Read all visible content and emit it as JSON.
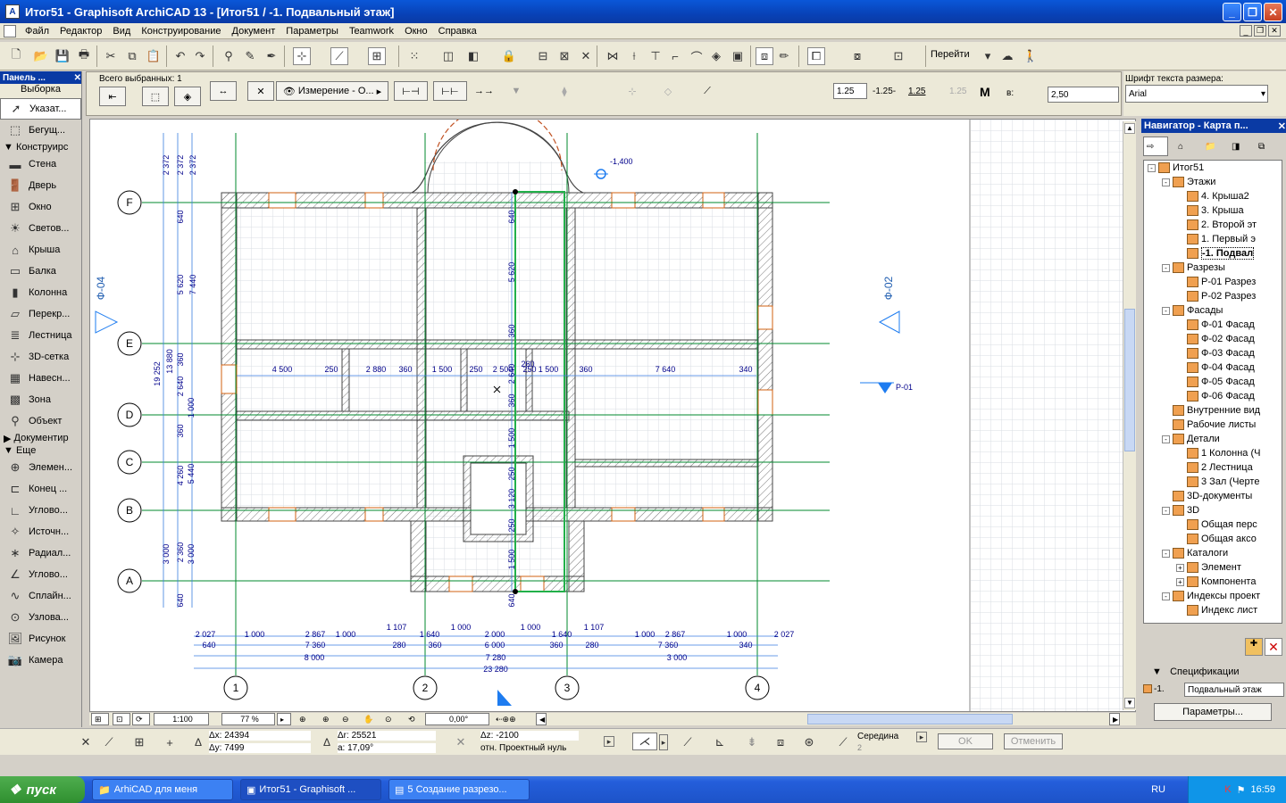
{
  "window": {
    "title": "Итог51 - Graphisoft ArchiCAD 13 - [Итог51 / -1. Подвальный этаж]"
  },
  "menu": [
    "Файл",
    "Редактор",
    "Вид",
    "Конструирование",
    "Документ",
    "Параметры",
    "Teamwork",
    "Окно",
    "Справка"
  ],
  "toolbar": {
    "goto": "Перейти"
  },
  "palette": {
    "title": "Панель ...",
    "selection": "Выборка",
    "pointer": "Указат...",
    "marquee": "Бегущ...",
    "section_design": "Конструирс",
    "design_tools": [
      "Стена",
      "Дверь",
      "Окно",
      "Светов...",
      "Крыша",
      "Балка",
      "Колонна",
      "Перекр...",
      "Лестница",
      "3D-сетка",
      "Навесн...",
      "Зона",
      "Объект"
    ],
    "section_doc": "Документир",
    "section_more": "Еще",
    "more_tools": [
      "Элемен...",
      "Конец ...",
      "Углово...",
      "Источн...",
      "Радиал...",
      "Углово...",
      "Сплайн...",
      "Узлова...",
      "Рисунок",
      "Камера"
    ]
  },
  "infobox": {
    "selected": "Всего выбранных: 1",
    "dim_type": "Измерение - О...",
    "val1": "1.25",
    "val2": "-1.25-",
    "val3": "1.25",
    "val4": "1.25",
    "scale_label": "в:",
    "scale_value": "2,50",
    "font_label": "Шрифт текста размера:",
    "font_value": "Arial"
  },
  "navigator": {
    "title": "Навигатор - Карта п...",
    "tree": [
      {
        "label": "Итог51",
        "level": 0,
        "exp": "-"
      },
      {
        "label": "Этажи",
        "level": 1,
        "exp": "-"
      },
      {
        "label": "4. Крыша2",
        "level": 2
      },
      {
        "label": "3. Крыша",
        "level": 2
      },
      {
        "label": "2. Второй эт",
        "level": 2
      },
      {
        "label": "1. Первый э",
        "level": 2
      },
      {
        "label": "-1. Подвал",
        "level": 2,
        "bold": true
      },
      {
        "label": "Разрезы",
        "level": 1,
        "exp": "-"
      },
      {
        "label": "Р-01 Разрез",
        "level": 2
      },
      {
        "label": "Р-02 Разрез",
        "level": 2
      },
      {
        "label": "Фасады",
        "level": 1,
        "exp": "-"
      },
      {
        "label": "Ф-01 Фасад",
        "level": 2
      },
      {
        "label": "Ф-02 Фасад",
        "level": 2
      },
      {
        "label": "Ф-03 Фасад",
        "level": 2
      },
      {
        "label": "Ф-04 Фасад",
        "level": 2
      },
      {
        "label": "Ф-05 Фасад",
        "level": 2
      },
      {
        "label": "Ф-06 Фасад",
        "level": 2
      },
      {
        "label": "Внутренние вид",
        "level": 1
      },
      {
        "label": "Рабочие листы",
        "level": 1
      },
      {
        "label": "Детали",
        "level": 1,
        "exp": "-"
      },
      {
        "label": "1 Колонна (Ч",
        "level": 2
      },
      {
        "label": "2 Лестница",
        "level": 2
      },
      {
        "label": "3 Зал (Черте",
        "level": 2
      },
      {
        "label": "3D-документы",
        "level": 1
      },
      {
        "label": "3D",
        "level": 1,
        "exp": "-"
      },
      {
        "label": "Общая перс",
        "level": 2
      },
      {
        "label": "Общая аксо",
        "level": 2
      },
      {
        "label": "Каталоги",
        "level": 1,
        "exp": "-"
      },
      {
        "label": "Элемент",
        "level": 2,
        "exp": "+"
      },
      {
        "label": "Компонента",
        "level": 2,
        "exp": "+"
      },
      {
        "label": "Индексы проект",
        "level": 1,
        "exp": "-"
      },
      {
        "label": "Индекс лист",
        "level": 2
      }
    ],
    "spec_title": "Спецификации",
    "story_num": "-1.",
    "story_name": "Подвальный этаж",
    "params_button": "Параметры..."
  },
  "statusbar": {
    "scale": "1:100",
    "zoom": "77 %",
    "angle": "0,00°",
    "dx": "Δx: 24394",
    "dy": "Δy: 7499",
    "dr": "Δr: 25521",
    "a": "a: 17,09°",
    "dz": "Δz: -2100",
    "ref": "отн. Проектный нуль",
    "snap": "Середина",
    "snap_num": "2",
    "ok": "OK",
    "cancel": "Отменить"
  },
  "plan": {
    "grid_rows": [
      "F",
      "E",
      "D",
      "C",
      "B",
      "A"
    ],
    "grid_cols": [
      "1",
      "2",
      "3",
      "4"
    ],
    "level_mark": "-1,400",
    "elev_left": "Ф-04",
    "elev_right": "Ф-02",
    "section": "Р-01",
    "vdims_left": [
      "2 372",
      "2 372",
      "2 372",
      "640",
      "5 620",
      "7 440",
      "360",
      "19 252",
      "13 880",
      "2 640",
      "1 000",
      "360",
      "4 260",
      "5 440",
      "3 000",
      "2 360",
      "3 000",
      "640"
    ],
    "vdims_center": [
      "640",
      "5 620",
      "360",
      "2 640",
      "360",
      "1 500",
      "250",
      "3 120",
      "250",
      "1 500",
      "640"
    ],
    "row_dims": [
      "4 500",
      "250",
      "2 880",
      "360",
      "1 500",
      "250",
      "2 500",
      "250",
      "1 500",
      "360",
      "7 640",
      "340",
      "260"
    ],
    "bottom_row1": [
      "2 027",
      "1 000",
      "2 867",
      "1 000",
      "1 107",
      "1 640",
      "1 000",
      "2 000",
      "1 000",
      "1 640",
      "1 107",
      "1 000",
      "2 867",
      "1 000",
      "2 027"
    ],
    "bottom_row2": [
      "640",
      "7 360",
      "280",
      "360",
      "6 000",
      "360",
      "280",
      "7 360",
      "340"
    ],
    "bottom_row3": [
      "8 000",
      "7 280",
      "3 000"
    ],
    "bottom_total": "23 280"
  },
  "taskbar": {
    "start": "пуск",
    "tasks": [
      "ArhiCAD для меня",
      "Итог51 - Graphisoft ...",
      "5 Создание разрезо..."
    ],
    "lang": "RU",
    "time": "16:59"
  }
}
